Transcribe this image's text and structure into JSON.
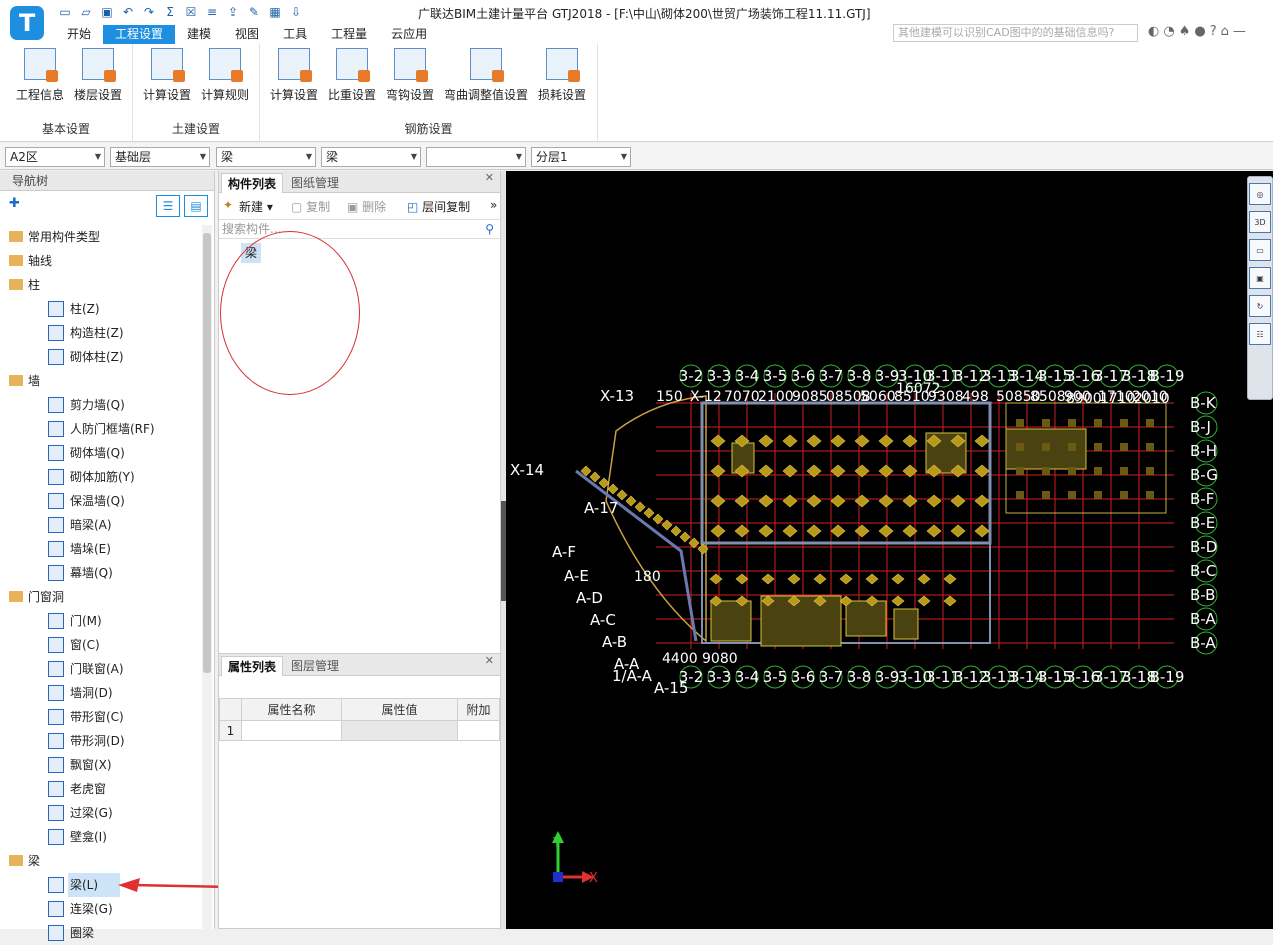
{
  "app": {
    "logo_letter": "T",
    "title": "广联达BIM土建计量平台 GTJ2018 - [F:\\中山\\砌体200\\世贸广场装饰工程11.11.GTJ]",
    "search_placeholder": "其他建模可以识别CAD图中的的基础信息吗?",
    "quick_access": [
      "new-file-icon",
      "open-folder-icon",
      "save-icon",
      "undo-icon",
      "redo-icon",
      "sum-icon",
      "delete-icon",
      "eq-icon",
      "export-icon",
      "edit-icon",
      "grid-icon",
      "import-icon"
    ]
  },
  "menu": {
    "items": [
      "开始",
      "工程设置",
      "建模",
      "视图",
      "工具",
      "工程量",
      "云应用"
    ],
    "active": "工程设置"
  },
  "ribbon": {
    "groups": [
      {
        "label": "基本设置",
        "buttons": [
          "工程信息",
          "楼层设置"
        ]
      },
      {
        "label": "土建设置",
        "buttons": [
          "计算设置",
          "计算规则"
        ]
      },
      {
        "label": "钢筋设置",
        "buttons": [
          "计算设置",
          "比重设置",
          "弯钩设置",
          "弯曲调整值设置",
          "损耗设置"
        ]
      }
    ]
  },
  "filters": [
    "A2区",
    "基础层",
    "梁",
    "梁",
    "",
    "分层1"
  ],
  "nav": {
    "title": "导航树",
    "tree": [
      {
        "t": "f",
        "label": "常用构件类型"
      },
      {
        "t": "f",
        "label": "轴线"
      },
      {
        "t": "f",
        "label": "柱"
      },
      {
        "t": "c",
        "label": "柱(Z)",
        "icon": "column-icon"
      },
      {
        "t": "c",
        "label": "构造柱(Z)",
        "icon": "structural-column-icon"
      },
      {
        "t": "c",
        "label": "砌体柱(Z)",
        "icon": "masonry-column-icon"
      },
      {
        "t": "f",
        "label": "墙"
      },
      {
        "t": "c",
        "label": "剪力墙(Q)",
        "icon": "shear-wall-icon"
      },
      {
        "t": "c",
        "label": "人防门框墙(RF)",
        "icon": "civil-defense-door-wall-icon"
      },
      {
        "t": "c",
        "label": "砌体墙(Q)",
        "icon": "masonry-wall-icon"
      },
      {
        "t": "c",
        "label": "砌体加筋(Y)",
        "icon": "masonry-rebar-icon"
      },
      {
        "t": "c",
        "label": "保温墙(Q)",
        "icon": "insulation-wall-icon"
      },
      {
        "t": "c",
        "label": "暗梁(A)",
        "icon": "hidden-beam-icon"
      },
      {
        "t": "c",
        "label": "墙垛(E)",
        "icon": "wall-pier-icon"
      },
      {
        "t": "c",
        "label": "幕墙(Q)",
        "icon": "curtain-wall-icon"
      },
      {
        "t": "f",
        "label": "门窗洞"
      },
      {
        "t": "c",
        "label": "门(M)",
        "icon": "door-icon"
      },
      {
        "t": "c",
        "label": "窗(C)",
        "icon": "window-icon"
      },
      {
        "t": "c",
        "label": "门联窗(A)",
        "icon": "door-window-icon"
      },
      {
        "t": "c",
        "label": "墙洞(D)",
        "icon": "wall-hole-icon"
      },
      {
        "t": "c",
        "label": "带形窗(C)",
        "icon": "strip-window-icon"
      },
      {
        "t": "c",
        "label": "带形洞(D)",
        "icon": "strip-hole-icon"
      },
      {
        "t": "c",
        "label": "飘窗(X)",
        "icon": "bay-window-icon"
      },
      {
        "t": "c",
        "label": "老虎窗",
        "icon": "dormer-window-icon"
      },
      {
        "t": "c",
        "label": "过梁(G)",
        "icon": "lintel-icon"
      },
      {
        "t": "c",
        "label": "壁龛(I)",
        "icon": "niche-icon"
      },
      {
        "t": "f",
        "label": "梁"
      },
      {
        "t": "c",
        "label": "梁(L)",
        "icon": "beam-icon",
        "selected": true
      },
      {
        "t": "c",
        "label": "连梁(G)",
        "icon": "coupling-beam-icon"
      },
      {
        "t": "c",
        "label": "圈梁",
        "icon": "ring-beam-icon"
      }
    ]
  },
  "components": {
    "tabs": [
      "构件列表",
      "图纸管理"
    ],
    "toolbar": {
      "new": "新建",
      "copy": "复制",
      "delete": "删除",
      "floor_copy": "层间复制"
    },
    "search_placeholder": "搜索构件...",
    "items": [
      "梁"
    ]
  },
  "properties": {
    "tabs": [
      "属性列表",
      "图层管理"
    ],
    "columns": [
      "属性名称",
      "属性值",
      "附加"
    ],
    "rows": [
      {
        "n": "1",
        "name": "",
        "value": "",
        "extra": ""
      }
    ]
  },
  "canvas": {
    "axis_x": "X",
    "axis_y": "Y",
    "top_axis_labels": [
      "3-2",
      "3-3",
      "3-4",
      "3-5",
      "3-6",
      "3-7",
      "3-8",
      "3-9",
      "3-10",
      "3-11",
      "3-12",
      "3-13",
      "3-14",
      "3-15",
      "3-16",
      "3-17",
      "3-18",
      "B-19"
    ],
    "bottom_axis_labels": [
      "3-2",
      "3-3",
      "3-4",
      "3-5",
      "3-6",
      "3-7",
      "3-8",
      "3-9",
      "3-10",
      "3-11",
      "3-12",
      "3-13",
      "3-14",
      "3-15",
      "3-16",
      "3-17",
      "3-18",
      "B-19"
    ],
    "right_axis_labels": [
      "B-K",
      "B-J",
      "B-H",
      "B-G",
      "B-F",
      "B-E",
      "B-D",
      "B-C",
      "B-B",
      "B-A",
      "B-A"
    ],
    "left_axis_labels": [
      "X-13",
      "X-14",
      "A-17",
      "A-F",
      "A-E",
      "A-D",
      "A-C",
      "A-B",
      "A-A",
      "1/A-A",
      "A-15"
    ],
    "dims": [
      "150",
      "X-12",
      "7070",
      "2100",
      "9085",
      "08508",
      "5060",
      "8510",
      "9308",
      "498",
      "50850",
      "8508",
      "900",
      "1710",
      "2010",
      "16072",
      "180",
      "8900",
      "1710",
      "2010",
      "4400",
      "9080"
    ]
  }
}
